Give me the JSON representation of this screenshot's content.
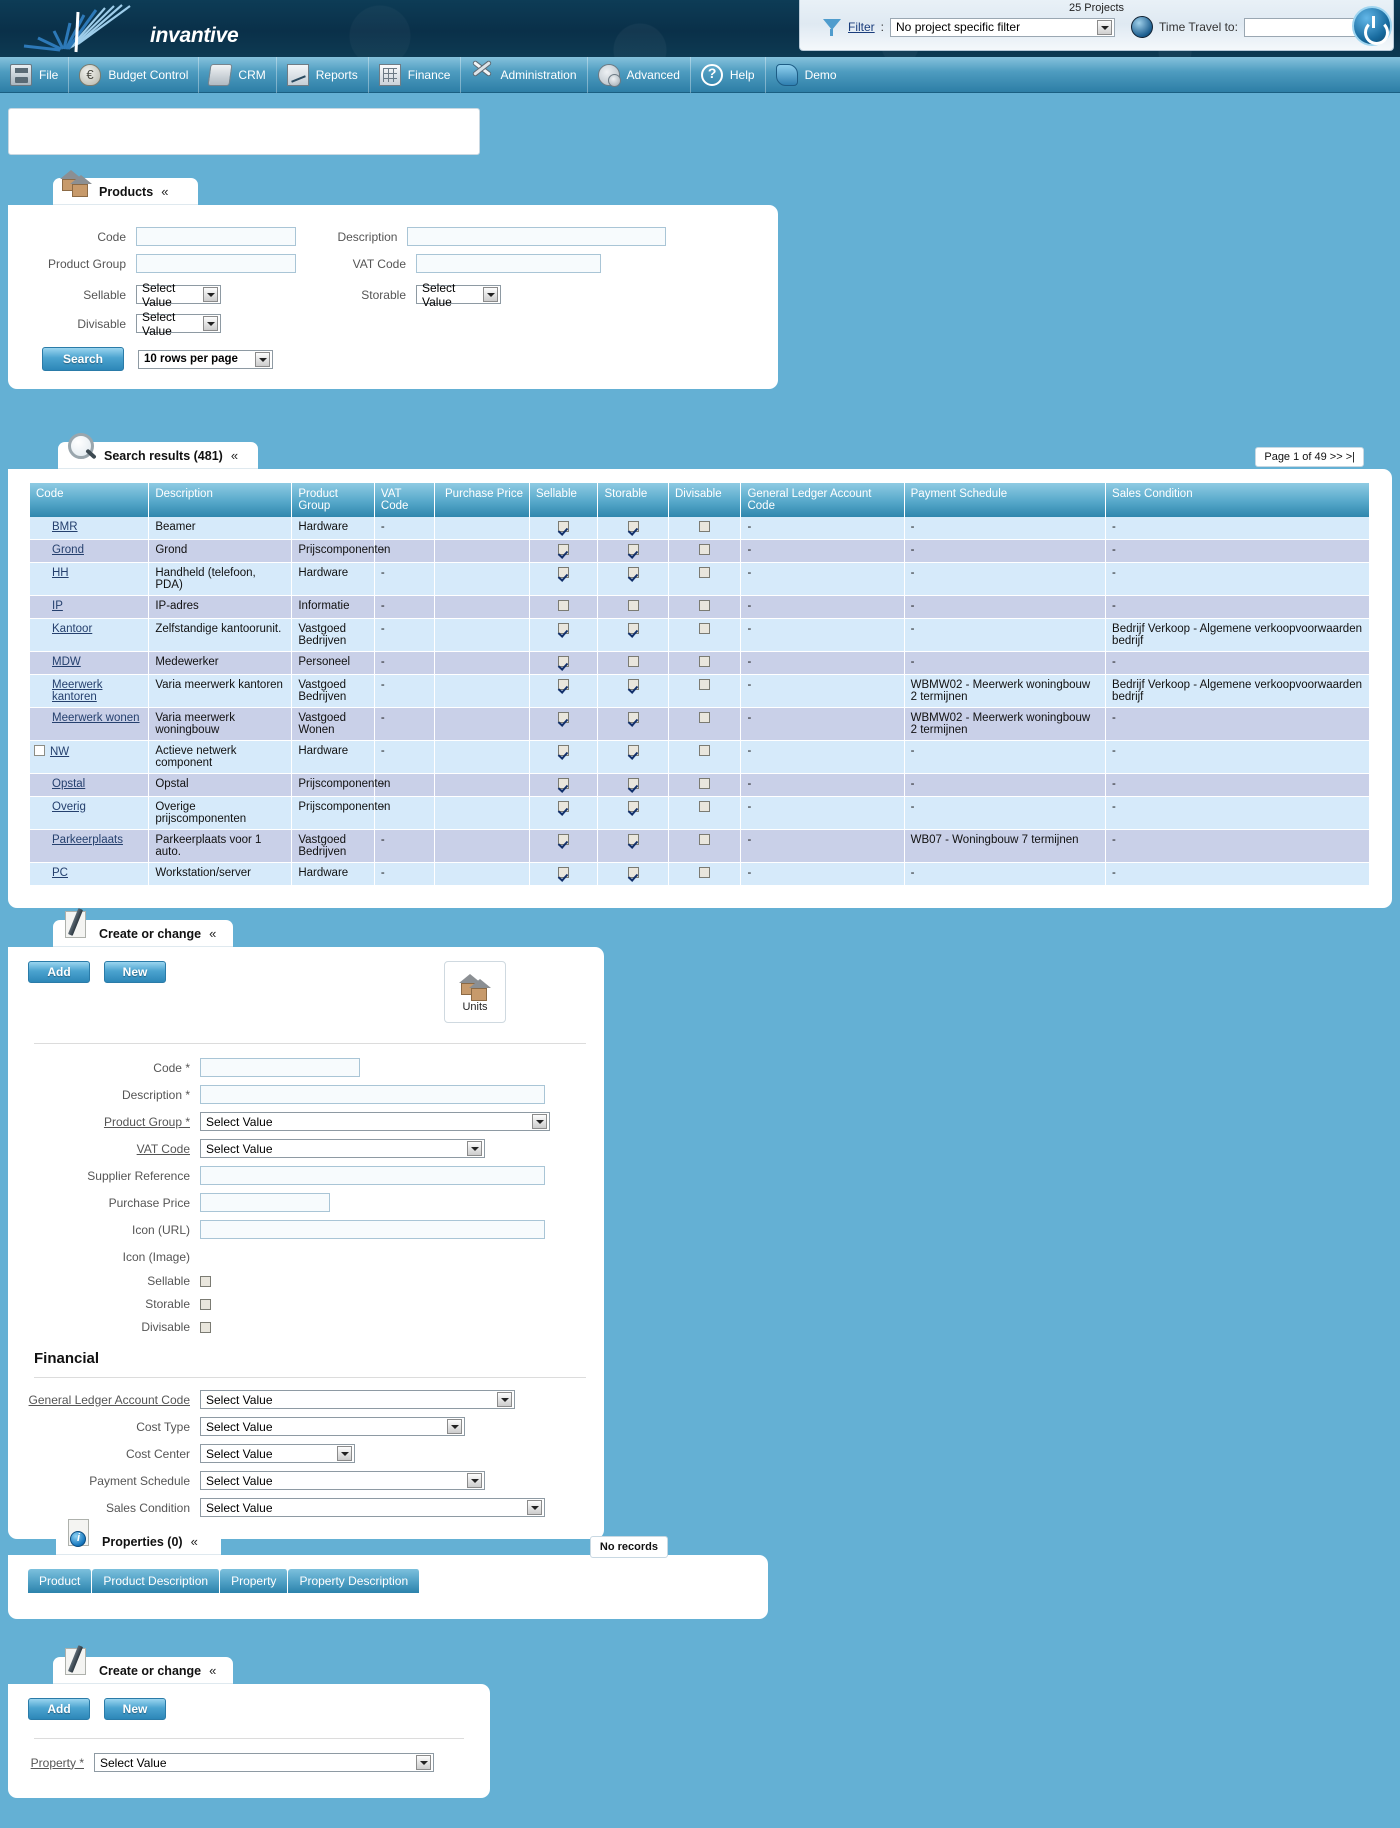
{
  "header": {
    "logo_text": "invantive",
    "project_count": "25 Projects",
    "filter_label": "Filter",
    "filter_colon": ":",
    "filter_value": "No project specific filter",
    "time_travel_label": "Time Travel to:",
    "time_travel_value": "",
    "power_icon": "power-icon"
  },
  "menu": {
    "items": [
      {
        "label": "File",
        "icon": "file-icon"
      },
      {
        "label": "Budget Control",
        "icon": "money-icon"
      },
      {
        "label": "CRM",
        "icon": "handshake-icon"
      },
      {
        "label": "Reports",
        "icon": "chart-icon"
      },
      {
        "label": "Finance",
        "icon": "calculator-icon"
      },
      {
        "label": "Administration",
        "icon": "tools-icon"
      },
      {
        "label": "Advanced",
        "icon": "gears-icon"
      },
      {
        "label": "Help",
        "icon": "question-icon"
      },
      {
        "label": "Demo",
        "icon": "demo-icon"
      }
    ]
  },
  "products_panel": {
    "title": "Products",
    "icon": "house-icon",
    "collapse_glyph": "«",
    "fields": {
      "code_label": "Code",
      "code_value": "",
      "description_label": "Description",
      "description_value": "",
      "product_group_label": "Product Group",
      "product_group_value": "",
      "vat_code_label": "VAT Code",
      "vat_code_value": "",
      "sellable_label": "Sellable",
      "sellable_value": "Select Value",
      "storable_label": "Storable",
      "storable_value": "Select Value",
      "divisable_label": "Divisable",
      "divisable_value": "Select Value"
    },
    "search_button": "Search",
    "rows_per_page": "10 rows per page"
  },
  "results_panel": {
    "title": "Search results (481)",
    "icon": "magnifier-icon",
    "collapse_glyph": "«",
    "pager": "Page 1 of 49 >> >|",
    "columns": [
      "Code",
      "Description",
      "Product Group",
      "VAT Code",
      "Purchase Price",
      "Sellable",
      "Storable",
      "Divisable",
      "General Ledger Account Code",
      "Payment Schedule",
      "Sales Condition"
    ],
    "rows": [
      {
        "code": "BMR",
        "description": "Beamer",
        "group": "Hardware",
        "vat": "-",
        "price": "",
        "sellable": true,
        "storable": true,
        "divisable": false,
        "gl": "-",
        "payment": "-",
        "sales": "-",
        "selectable": false
      },
      {
        "code": "Grond",
        "description": "Grond",
        "group": "Prijscomponenten",
        "vat": "-",
        "price": "",
        "sellable": true,
        "storable": true,
        "divisable": false,
        "gl": "-",
        "payment": "-",
        "sales": "-",
        "selectable": false
      },
      {
        "code": "HH",
        "description": "Handheld (telefoon, PDA)",
        "group": "Hardware",
        "vat": "-",
        "price": "",
        "sellable": true,
        "storable": true,
        "divisable": false,
        "gl": "-",
        "payment": "-",
        "sales": "-",
        "selectable": false
      },
      {
        "code": "IP",
        "description": "IP-adres",
        "group": "Informatie",
        "vat": "-",
        "price": "",
        "sellable": false,
        "storable": false,
        "divisable": false,
        "gl": "-",
        "payment": "-",
        "sales": "-",
        "selectable": false
      },
      {
        "code": "Kantoor",
        "description": "Zelfstandige kantoorunit.",
        "group": "Vastgoed Bedrijven",
        "vat": "-",
        "price": "",
        "sellable": true,
        "storable": true,
        "divisable": false,
        "gl": "-",
        "payment": "-",
        "sales": "Bedrijf Verkoop - Algemene verkoopvoorwaarden bedrijf",
        "selectable": false
      },
      {
        "code": "MDW",
        "description": "Medewerker",
        "group": "Personeel",
        "vat": "-",
        "price": "",
        "sellable": true,
        "storable": false,
        "divisable": false,
        "gl": "-",
        "payment": "-",
        "sales": "-",
        "selectable": false
      },
      {
        "code": "Meerwerk kantoren",
        "description": "Varia meerwerk kantoren",
        "group": "Vastgoed Bedrijven",
        "vat": "-",
        "price": "",
        "sellable": true,
        "storable": true,
        "divisable": false,
        "gl": "-",
        "payment": "WBMW02 - Meerwerk woningbouw 2 termijnen",
        "sales": "Bedrijf Verkoop - Algemene verkoopvoorwaarden bedrijf",
        "selectable": false
      },
      {
        "code": "Meerwerk wonen",
        "description": "Varia meerwerk woningbouw",
        "group": "Vastgoed Wonen",
        "vat": "-",
        "price": "",
        "sellable": true,
        "storable": true,
        "divisable": false,
        "gl": "-",
        "payment": "WBMW02 - Meerwerk woningbouw 2 termijnen",
        "sales": "-",
        "selectable": false
      },
      {
        "code": "NW",
        "description": "Actieve netwerk component",
        "group": "Hardware",
        "vat": "-",
        "price": "",
        "sellable": true,
        "storable": true,
        "divisable": false,
        "gl": "-",
        "payment": "-",
        "sales": "-",
        "selectable": true
      },
      {
        "code": "Opstal",
        "description": "Opstal",
        "group": "Prijscomponenten",
        "vat": "-",
        "price": "",
        "sellable": true,
        "storable": true,
        "divisable": false,
        "gl": "-",
        "payment": "-",
        "sales": "-",
        "selectable": false
      },
      {
        "code": "Overig",
        "description": "Overige prijscomponenten",
        "group": "Prijscomponenten",
        "vat": "-",
        "price": "",
        "sellable": true,
        "storable": true,
        "divisable": false,
        "gl": "-",
        "payment": "-",
        "sales": "-",
        "selectable": false
      },
      {
        "code": "Parkeerplaats",
        "description": "Parkeerplaats voor 1 auto.",
        "group": "Vastgoed Bedrijven",
        "vat": "-",
        "price": "",
        "sellable": true,
        "storable": true,
        "divisable": false,
        "gl": "-",
        "payment": "WB07 - Woningbouw 7 termijnen",
        "sales": "-",
        "selectable": false
      },
      {
        "code": "PC",
        "description": "Workstation/server",
        "group": "Hardware",
        "vat": "-",
        "price": "",
        "sellable": true,
        "storable": true,
        "divisable": false,
        "gl": "-",
        "payment": "-",
        "sales": "-",
        "selectable": false
      }
    ]
  },
  "create_panel": {
    "title": "Create or change",
    "icon": "pencil-icon",
    "collapse_glyph": "«",
    "add_button": "Add",
    "new_button": "New",
    "units_label": "Units",
    "units_icon": "house-icon",
    "fields": {
      "code_label": "Code *",
      "code_value": "",
      "description_label": "Description *",
      "description_value": "",
      "product_group_label": "Product Group *",
      "product_group_value": "Select Value",
      "vat_code_label": "VAT Code",
      "vat_code_value": "Select Value",
      "supplier_reference_label": "Supplier Reference",
      "supplier_reference_value": "",
      "purchase_price_label": "Purchase Price",
      "purchase_price_value": "",
      "icon_url_label": "Icon (URL)",
      "icon_url_value": "",
      "icon_image_label": "Icon (Image)",
      "sellable_label": "Sellable",
      "storable_label": "Storable",
      "divisable_label": "Divisable"
    },
    "financial_title": "Financial",
    "financial": {
      "gl_label": "General Ledger Account Code",
      "gl_value": "Select Value",
      "cost_type_label": "Cost Type",
      "cost_type_value": "Select Value",
      "cost_center_label": "Cost Center",
      "cost_center_value": "Select Value",
      "payment_schedule_label": "Payment Schedule",
      "payment_schedule_value": "Select Value",
      "sales_condition_label": "Sales Condition",
      "sales_condition_value": "Select Value"
    }
  },
  "properties_panel": {
    "title": "Properties (0)",
    "icon": "info-icon",
    "collapse_glyph": "«",
    "no_records": "No records",
    "tabs": [
      "Product",
      "Product Description",
      "Property",
      "Property Description"
    ]
  },
  "property_create_panel": {
    "title": "Create or change",
    "icon": "pencil-icon",
    "collapse_glyph": "«",
    "add_button": "Add",
    "new_button": "New",
    "property_label": "Property *",
    "property_value": "Select Value"
  }
}
